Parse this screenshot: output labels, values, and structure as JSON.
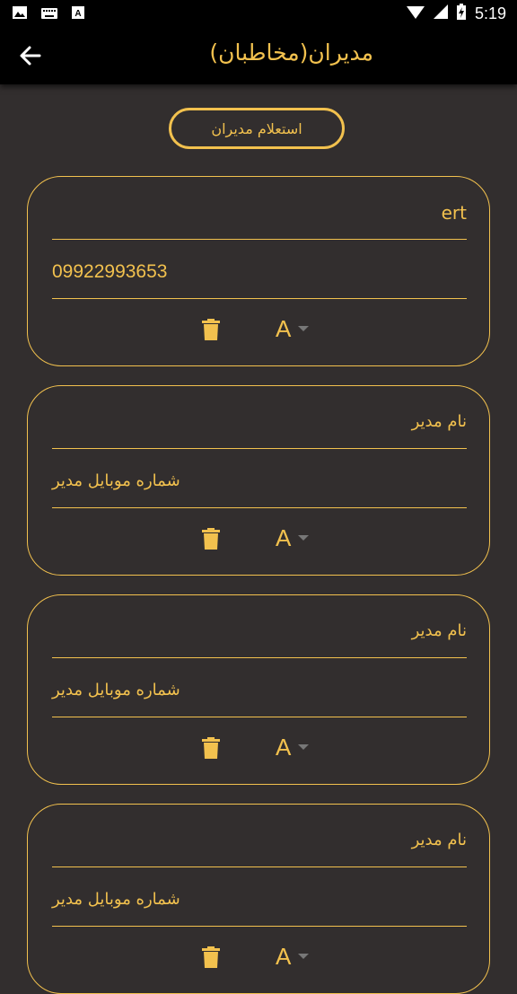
{
  "status_bar": {
    "time": "5:19"
  },
  "app_bar": {
    "title": "مدیران(مخاطبان)"
  },
  "inquiry_button": {
    "label": "استعلام مدیران"
  },
  "cards": [
    {
      "name": "ert",
      "phone": "09922993653",
      "role": "A",
      "name_is_placeholder": false
    },
    {
      "name": "نام مدیر",
      "phone": "شماره موبایل مدیر",
      "role": "A",
      "name_is_placeholder": true
    },
    {
      "name": "نام مدیر",
      "phone": "شماره موبایل مدیر",
      "role": "A",
      "name_is_placeholder": true
    },
    {
      "name": "نام مدیر",
      "phone": "شماره موبایل مدیر",
      "role": "A",
      "name_is_placeholder": true
    }
  ],
  "colors": {
    "accent": "#f2c14e",
    "background": "#322e2e",
    "bar": "#000000"
  }
}
